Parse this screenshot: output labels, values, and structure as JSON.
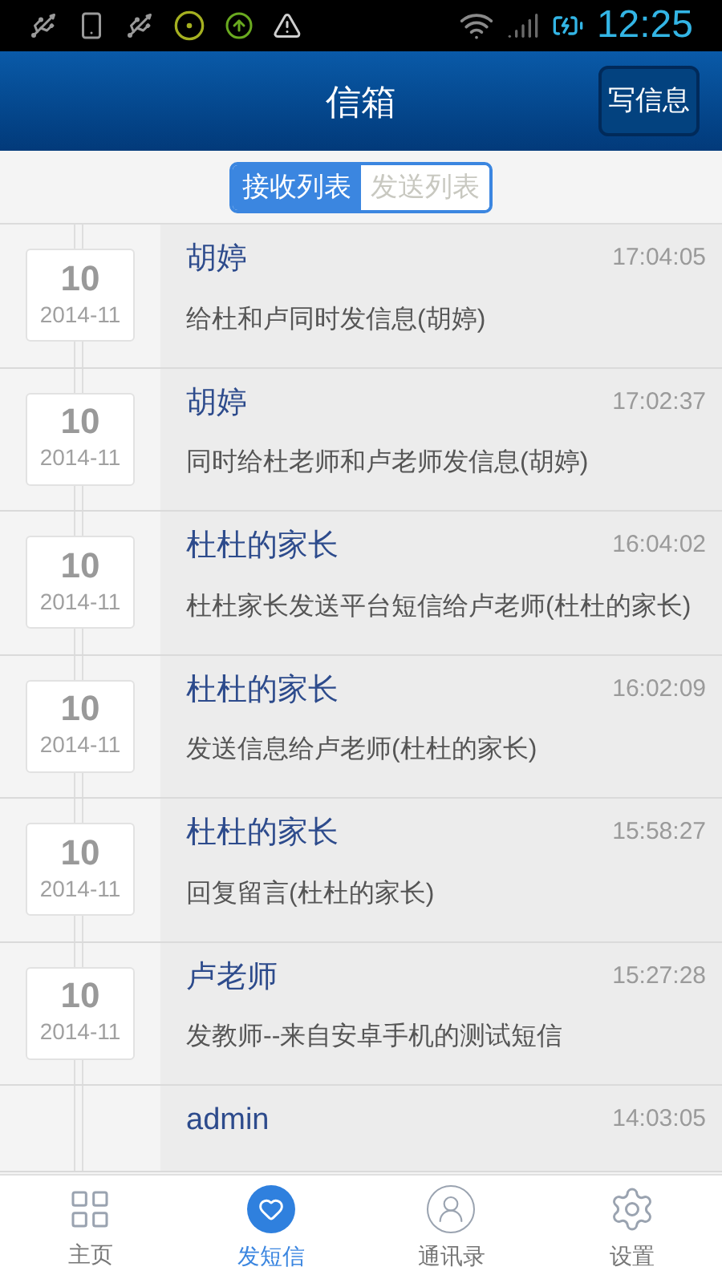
{
  "status_bar": {
    "time": "12:25"
  },
  "header": {
    "title": "信箱",
    "compose_button": "写信息"
  },
  "segments": [
    {
      "label": "接收列表",
      "selected": true
    },
    {
      "label": "发送列表",
      "selected": false
    }
  ],
  "messages": [
    {
      "day": "10",
      "month": "2014-11",
      "sender": "胡婷",
      "time": "17:04:05",
      "text": "给杜和卢同时发信息(胡婷)"
    },
    {
      "day": "10",
      "month": "2014-11",
      "sender": "胡婷",
      "time": "17:02:37",
      "text": "同时给杜老师和卢老师发信息(胡婷)"
    },
    {
      "day": "10",
      "month": "2014-11",
      "sender": "杜杜的家长",
      "time": "16:04:02",
      "text": "杜杜家长发送平台短信给卢老师(杜杜的家长)"
    },
    {
      "day": "10",
      "month": "2014-11",
      "sender": "杜杜的家长",
      "time": "16:02:09",
      "text": "发送信息给卢老师(杜杜的家长)"
    },
    {
      "day": "10",
      "month": "2014-11",
      "sender": "杜杜的家长",
      "time": "15:58:27",
      "text": "回复留言(杜杜的家长)"
    },
    {
      "day": "10",
      "month": "2014-11",
      "sender": "卢老师",
      "time": "15:27:28",
      "text": "发教师--来自安卓手机的测试短信"
    },
    {
      "sender": "admin",
      "time": "14:03:05"
    }
  ],
  "nav": [
    {
      "kind": "home",
      "label": "主页",
      "selected": false
    },
    {
      "kind": "sms",
      "label": "发短信",
      "selected": true
    },
    {
      "kind": "contacts",
      "label": "通讯录",
      "selected": false
    },
    {
      "kind": "settings",
      "label": "设置",
      "selected": false
    }
  ]
}
